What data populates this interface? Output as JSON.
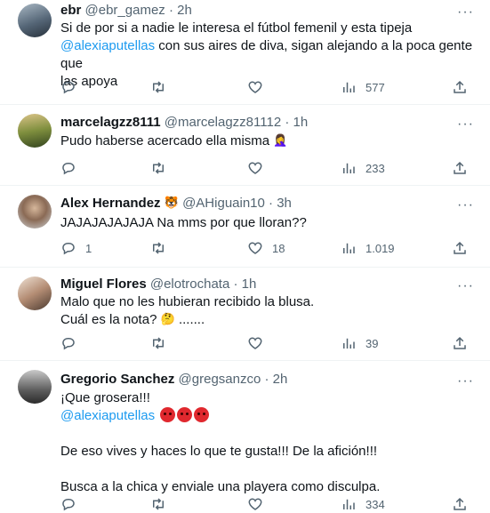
{
  "tweets": [
    {
      "name": "ebr",
      "handle": "@ebr_gamez",
      "time": "2h",
      "lines": [
        "Si de por si a nadie le interesa el fútbol femenil y esta tipeja",
        "con sus aires de diva, sigan alejando a la poca gente que",
        "las apoya"
      ],
      "mention": "@alexiaputellas",
      "replies": "",
      "retweets": "",
      "likes": "",
      "views": "577"
    },
    {
      "name": "marcelagzz8111",
      "handle": "@marcelagzz81112",
      "time": "1h",
      "lines": [
        "Pudo haberse acercado ella misma"
      ],
      "emoji": "🤦‍♀️",
      "replies": "",
      "retweets": "",
      "likes": "",
      "views": "233"
    },
    {
      "name": "Alex Hernandez",
      "name_emoji": "🐯",
      "handle": "@AHiguain10",
      "time": "3h",
      "lines": [
        "JAJAJAJAJAJA Na mms por que lloran??"
      ],
      "replies": "1",
      "retweets": "",
      "likes": "18",
      "views": "1.019"
    },
    {
      "name": "Miguel Flores",
      "handle": "@elotrochata",
      "time": "1h",
      "lines": [
        "Malo que no les hubieran recibido la blusa.",
        "Cuál es la nota?",
        "......."
      ],
      "emoji": "🤔",
      "replies": "",
      "retweets": "",
      "likes": "",
      "views": "39"
    },
    {
      "name": "Gregorio Sanchez",
      "handle": "@gregsanzco",
      "time": "2h",
      "lines": [
        "¡Que grosera!!!",
        "De eso vives y haces lo que te gusta!!! De la afición!!!",
        "Busca a la chica y enviale una playera como disculpa."
      ],
      "mention": "@alexiaputellas",
      "replies": "",
      "retweets": "",
      "likes": "",
      "views": "334"
    }
  ],
  "dot": "·",
  "more": "···",
  "icons": {
    "reply": "reply-icon",
    "retweet": "retweet-icon",
    "like": "heart-icon",
    "views": "views-icon",
    "share": "share-icon"
  },
  "colors": {
    "text": "#0f1419",
    "secondary": "#536471",
    "link": "#1d9bf0",
    "border": "#eff3f4"
  }
}
